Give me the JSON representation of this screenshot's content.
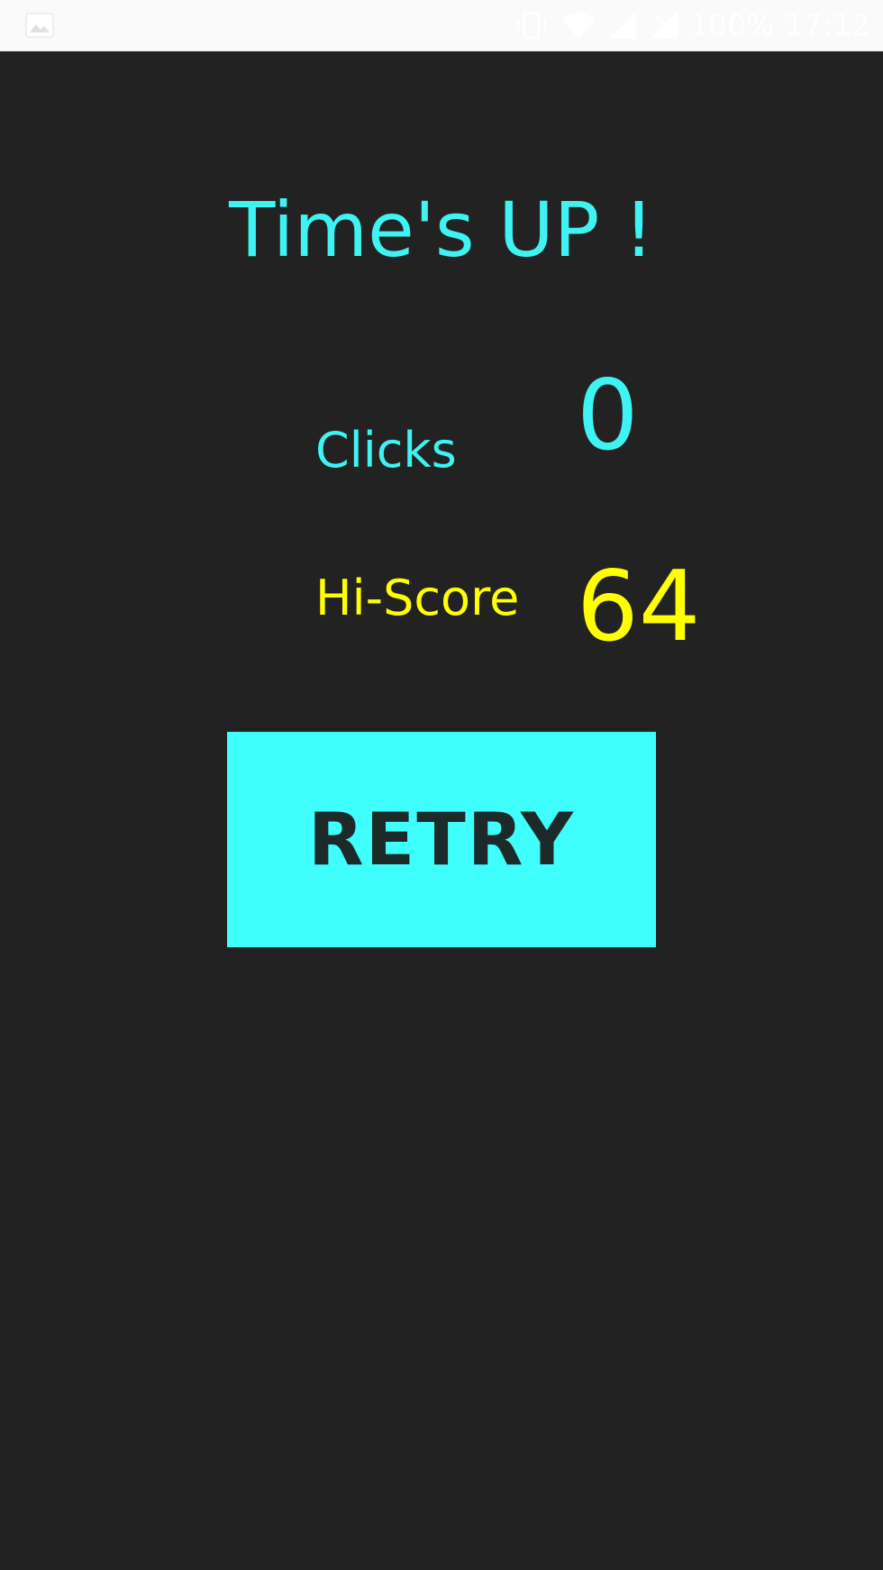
{
  "status_bar": {
    "battery": "100%",
    "time": "17:12",
    "icons": [
      "image-notification-icon",
      "vibrate-icon",
      "wifi-icon",
      "signal-icon",
      "signal-nodata-icon"
    ]
  },
  "game_over": {
    "title": "Time's UP !",
    "clicks_label": "Clicks",
    "clicks_value": "0",
    "hiscore_label": "Hi-Score",
    "hiscore_value": "64",
    "retry_label": "RETRY"
  },
  "colors": {
    "background": "#222222",
    "accent_cyan": "#3ff3f3",
    "accent_yellow": "#ffff00",
    "button_bg": "#3ffffc",
    "button_text": "#1d2a2a"
  }
}
